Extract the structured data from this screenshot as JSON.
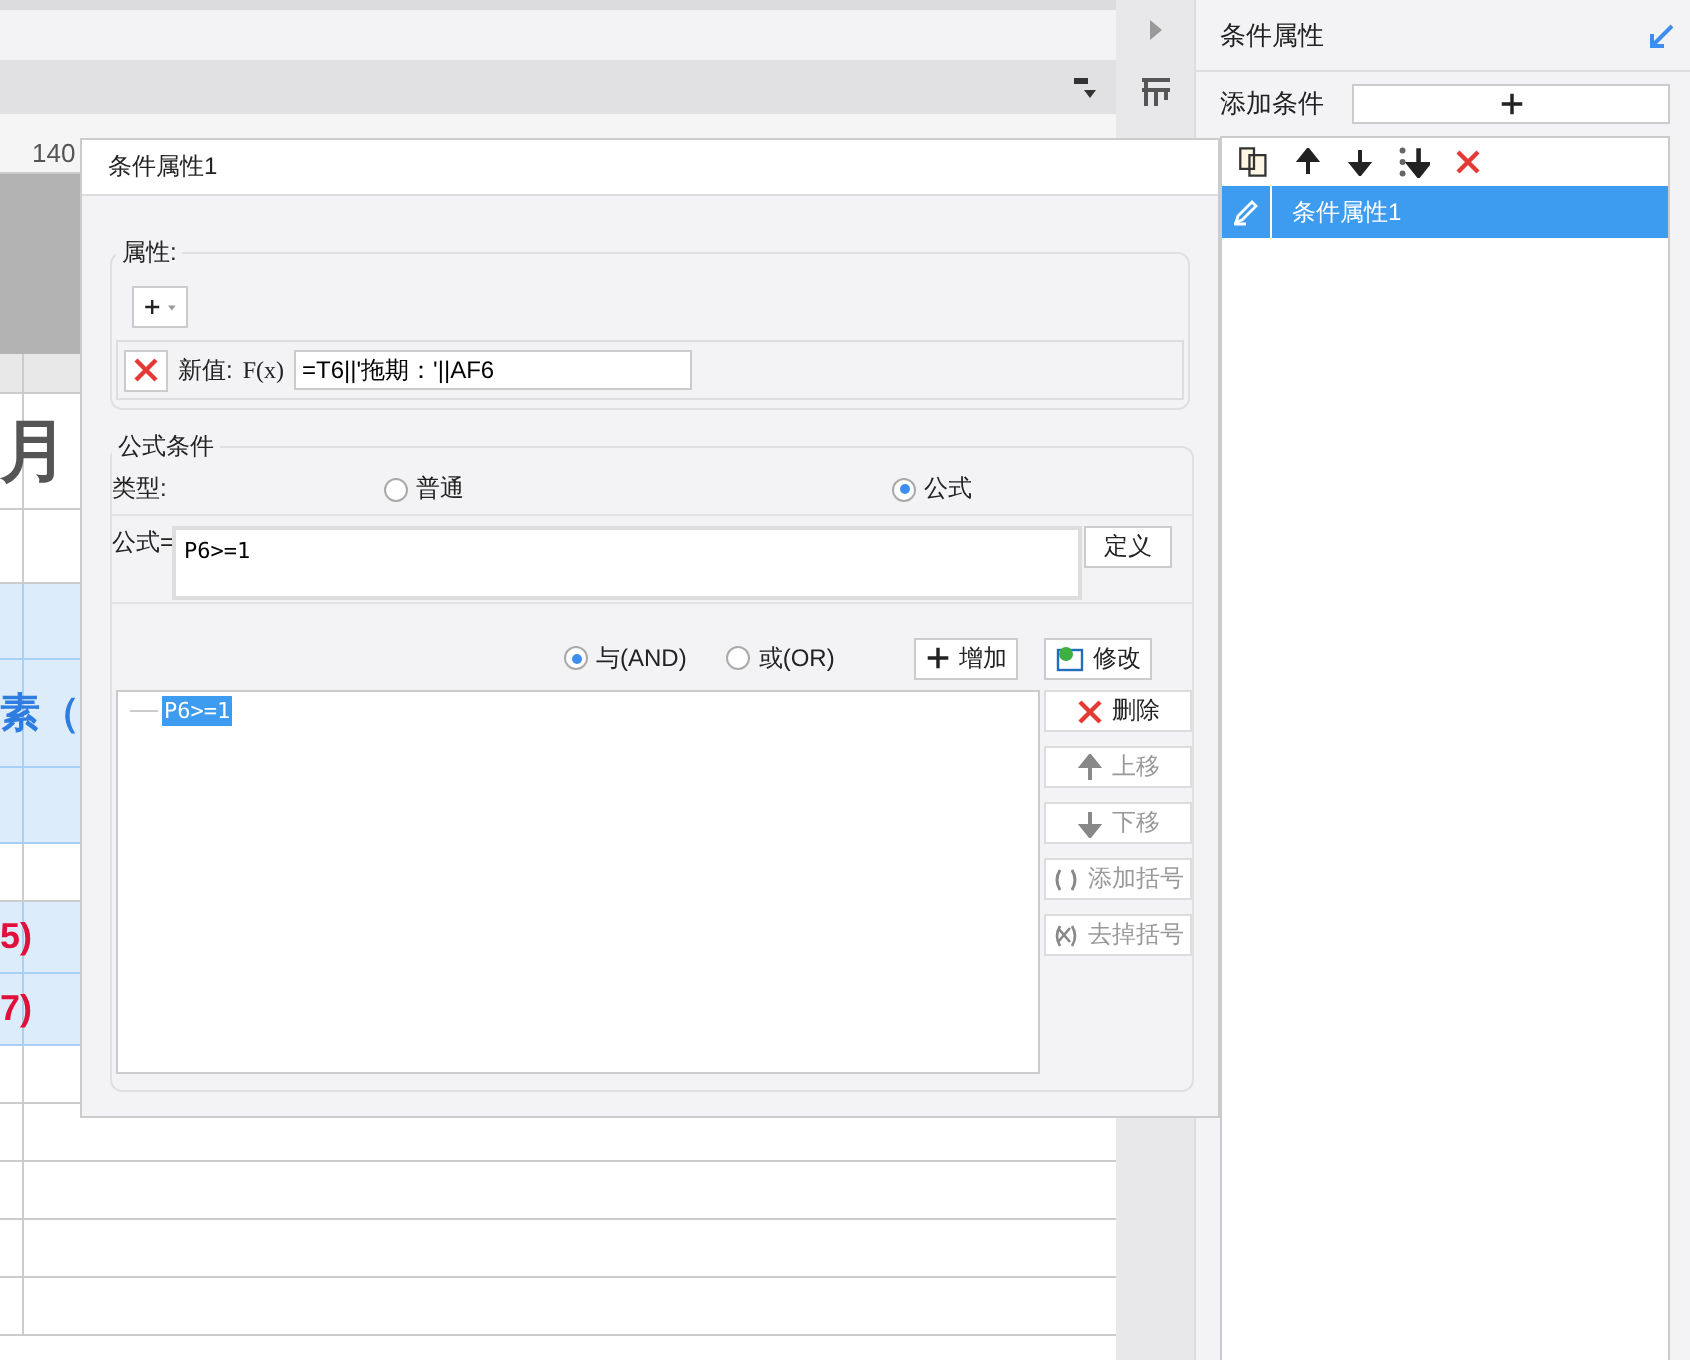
{
  "sheet": {
    "ruler": "140",
    "rows": [
      {
        "kind": "head"
      },
      {
        "kind": "title",
        "text": "月"
      },
      {
        "kind": "plain"
      },
      {
        "kind": "band"
      },
      {
        "kind": "band_title",
        "text": "素（"
      },
      {
        "kind": "band"
      },
      {
        "kind": "plain"
      },
      {
        "kind": "band_value",
        "text": "5)"
      },
      {
        "kind": "band_value",
        "text": "7)"
      },
      {
        "kind": "plain"
      },
      {
        "kind": "plain"
      },
      {
        "kind": "plain"
      },
      {
        "kind": "plain"
      },
      {
        "kind": "plain"
      }
    ]
  },
  "dialog": {
    "title": "条件属性1",
    "properties": {
      "legend": "属性:",
      "items": [
        {
          "label": "新值:",
          "formula_button": "F(x)",
          "value": "=T6||'拖期：'||AF6"
        }
      ]
    },
    "formula_condition": {
      "legend": "公式条件",
      "type_label": "类型:",
      "types": [
        {
          "label": "普通",
          "selected": false
        },
        {
          "label": "公式",
          "selected": true
        }
      ],
      "formula_label": "公式=",
      "formula": "P6>=1",
      "define_button": "定义",
      "logic": [
        {
          "label": "与(AND)",
          "selected": true
        },
        {
          "label": "或(OR)",
          "selected": false
        }
      ],
      "add_button": "增加",
      "modify_button": "修改",
      "conditions": [
        {
          "text": "P6>=1",
          "selected": true
        }
      ],
      "actions": [
        {
          "kind": "delete",
          "label": "删除",
          "disabled": false
        },
        {
          "kind": "up",
          "label": "上移",
          "disabled": true
        },
        {
          "kind": "down",
          "label": "下移",
          "disabled": true
        },
        {
          "kind": "add_paren",
          "label": "添加括号",
          "disabled": true
        },
        {
          "kind": "remove_paren",
          "label": "去掉括号",
          "disabled": true
        }
      ]
    }
  },
  "panel": {
    "title": "条件属性",
    "add_label": "添加条件",
    "items": [
      {
        "label": "条件属性1",
        "selected": true
      }
    ]
  }
}
